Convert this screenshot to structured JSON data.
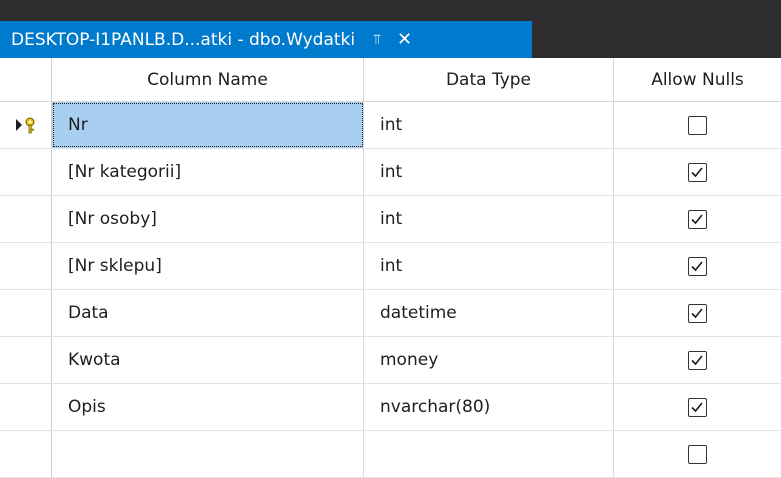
{
  "tab": {
    "title": "DESKTOP-I1PANLB.D...atki - dbo.Wydatki",
    "pin_glyph": "⫪",
    "close_glyph": "✕"
  },
  "headers": {
    "column_name": "Column Name",
    "data_type": "Data Type",
    "allow_nulls": "Allow Nulls"
  },
  "rows": [
    {
      "name": "Nr",
      "type": "int",
      "allow_nulls": false,
      "primary_key": true
    },
    {
      "name": "[Nr kategorii]",
      "type": "int",
      "allow_nulls": true
    },
    {
      "name": "[Nr osoby]",
      "type": "int",
      "allow_nulls": true
    },
    {
      "name": "[Nr sklepu]",
      "type": "int",
      "allow_nulls": true
    },
    {
      "name": "Data",
      "type": "datetime",
      "allow_nulls": true
    },
    {
      "name": "Kwota",
      "type": "money",
      "allow_nulls": true
    },
    {
      "name": "Opis",
      "type": "nvarchar(80)",
      "allow_nulls": true
    },
    {
      "name": "",
      "type": "",
      "allow_nulls": false
    }
  ],
  "icons": {
    "row_selector": "current-row-arrow-icon",
    "primary_key": "primary-key-icon"
  },
  "colors": {
    "tab_active": "#007acc",
    "tabstrip_bg": "#2d2d30",
    "selected_cell": "#a9cff0"
  }
}
